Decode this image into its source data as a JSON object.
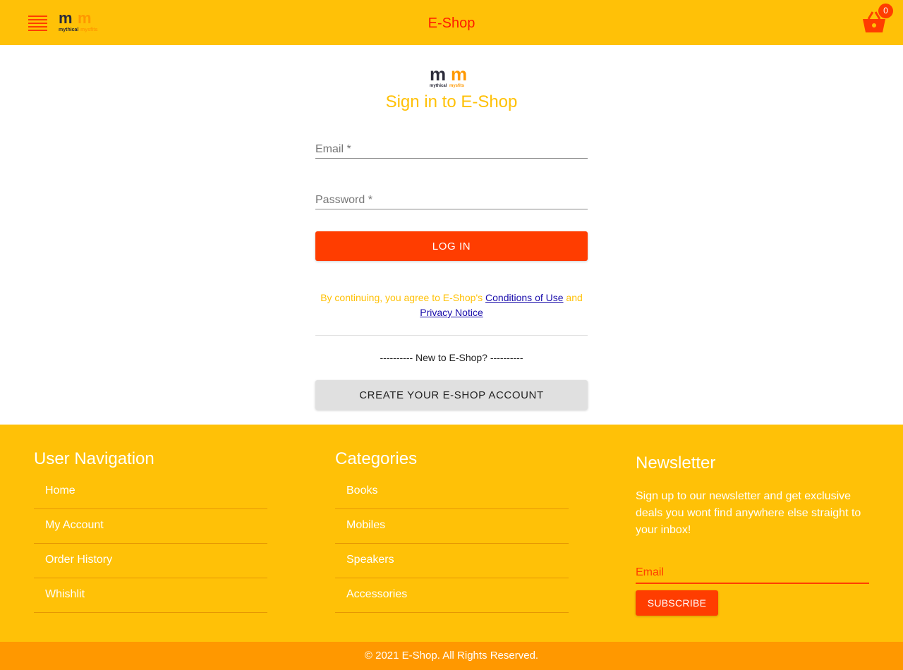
{
  "app": {
    "title": "E-Shop",
    "cart_count": "0",
    "logo_text": {
      "mark": "mm",
      "line1": "mythical",
      "line2": "mysfits"
    },
    "colors": {
      "header": "#ffc107",
      "accent": "#ff3d00",
      "footer_bottom": "#ff9800"
    }
  },
  "header": {
    "menu_icon": "hamburger-icon",
    "cart_icon": "basket-icon"
  },
  "signin": {
    "title": "Sign in to E-Shop",
    "email_placeholder": "Email *",
    "password_placeholder": "Password *",
    "login_label": "LOG IN",
    "terms_prefix": "By continuing, you agree to E-Shop's ",
    "terms_link": "Conditions of Use",
    "terms_and": " and",
    "privacy_link": "Privacy Notice",
    "new_to": "---------- New to E-Shop? ----------",
    "create_label": "CREATE YOUR E-SHOP ACCOUNT"
  },
  "footer": {
    "user_nav": {
      "title": "User Navigation",
      "items": [
        "Home",
        "My Account",
        "Order History",
        "Whishlit"
      ]
    },
    "categories": {
      "title": "Categories",
      "items": [
        "Books",
        "Mobiles",
        "Speakers",
        "Accessories"
      ]
    },
    "newsletter": {
      "title": "Newsletter",
      "text": "Sign up to our newsletter and get exclusive deals you wont find anywhere else straight to your inbox!",
      "email_placeholder": "Email",
      "subscribe_label": "SUBSCRIBE"
    },
    "copyright": "© 2021 E-Shop. All Rights Reserved."
  }
}
